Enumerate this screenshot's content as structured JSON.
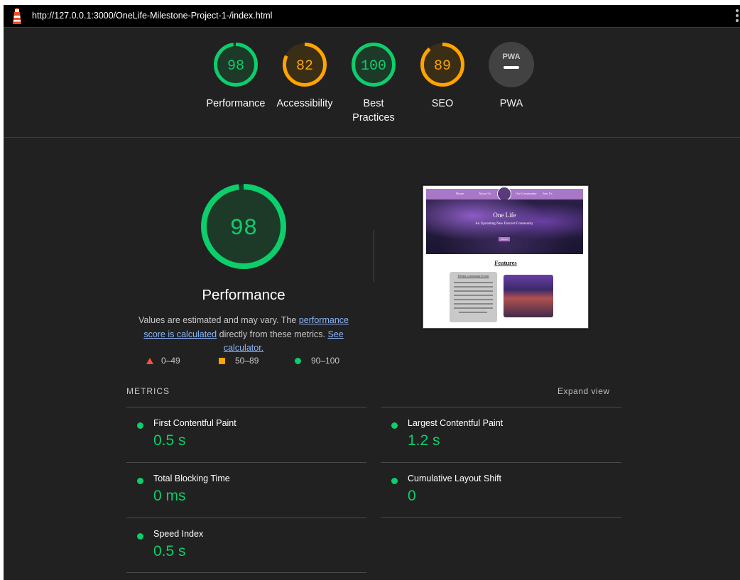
{
  "topbar": {
    "url": "http://127.0.0.1:3000/OneLife-Milestone-Project-1-/index.html"
  },
  "colors": {
    "pass": "#0cce6b",
    "average": "#ffa400",
    "fail": "#ff4e42",
    "na": "#9e9e9e"
  },
  "gauges": [
    {
      "score": "98",
      "label": "Performance",
      "value": 0.98,
      "status": "pass"
    },
    {
      "score": "82",
      "label": "Accessibility",
      "value": 0.82,
      "status": "average"
    },
    {
      "score": "100",
      "label": "Best Practices",
      "value": 1.0,
      "status": "pass"
    },
    {
      "score": "89",
      "label": "SEO",
      "value": 0.89,
      "status": "average"
    },
    {
      "score": "",
      "label": "PWA",
      "value": 0,
      "status": "na"
    }
  ],
  "performance": {
    "score": "98",
    "value": 0.98,
    "title": "Performance",
    "desc_before": "Values are estimated and may vary. The ",
    "link1": "performance score is calculated",
    "desc_mid": " directly from these metrics. ",
    "link2": "See calculator."
  },
  "legend": {
    "fail": "0–49",
    "average": "50–89",
    "pass": "90–100"
  },
  "screenshot": {
    "nav": [
      "Home",
      "About Us",
      "Our Community",
      "Join Us"
    ],
    "hero_title": "One Life",
    "hero_sub": "An Upcoming New Discord Community",
    "hero_button": "Join Us",
    "features": "Features",
    "card_title": "Weekly Community Events"
  },
  "metrics": {
    "heading": "METRICS",
    "expand": "Expand view",
    "items": [
      {
        "name": "First Contentful Paint",
        "value": "0.5 s"
      },
      {
        "name": "Largest Contentful Paint",
        "value": "1.2 s"
      },
      {
        "name": "Total Blocking Time",
        "value": "0 ms"
      },
      {
        "name": "Cumulative Layout Shift",
        "value": "0"
      },
      {
        "name": "Speed Index",
        "value": "0.5 s"
      }
    ]
  }
}
